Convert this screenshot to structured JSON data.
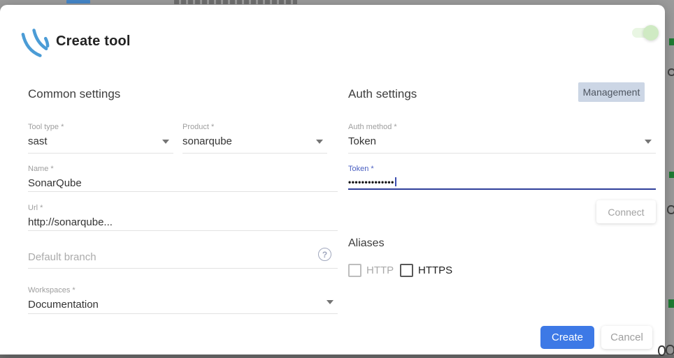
{
  "dialog": {
    "title": "Create tool",
    "toggle_on": true
  },
  "common": {
    "heading": "Common settings",
    "tool_type_label": "Tool type *",
    "tool_type_value": "sast",
    "product_label": "Product *",
    "product_value": "sonarqube",
    "name_label": "Name *",
    "name_value": "SonarQube",
    "url_label": "Url *",
    "url_value": "http://sonarqube...",
    "default_branch_placeholder": "Default branch",
    "workspaces_label": "Workspaces *",
    "workspaces_value": "Documentation"
  },
  "auth": {
    "heading": "Auth settings",
    "management_label": "Management",
    "auth_method_label": "Auth method *",
    "auth_method_value": "Token",
    "token_label": "Token *",
    "token_masked_value": "••••••••••••••",
    "connect_label": "Connect"
  },
  "aliases": {
    "heading": "Aliases",
    "options": [
      {
        "label": "HTTP",
        "checked": false
      },
      {
        "label": "HTTPS",
        "checked": false
      }
    ]
  },
  "footer": {
    "create_label": "Create",
    "cancel_label": "Cancel"
  },
  "icons": {
    "help_glyph": "?"
  },
  "colors": {
    "create_button": "#3d79e6",
    "focused_underline": "#2f3f9b",
    "token_label": "#4a5fc1",
    "logo_blue": "#4b9cd6",
    "toggle_green": "#cfeac3",
    "management_chip_bg": "#ccd6e5",
    "page_backdrop": "#9b9b9b"
  }
}
